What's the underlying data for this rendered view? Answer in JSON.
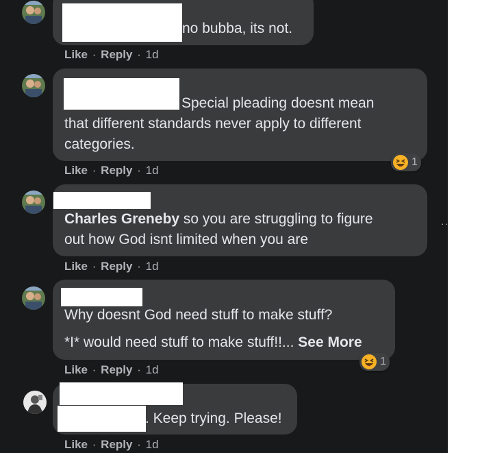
{
  "comments": [
    {
      "text": "no bubba, its not.",
      "actions": {
        "like": "Like",
        "reply": "Reply",
        "sep": "·",
        "time": "1d"
      }
    },
    {
      "text": "Special pleading doesnt mean that different standards never apply to different categories.",
      "line1": "Special pleading doesnt mean",
      "line2": "that different standards never apply to different",
      "line3": "categories.",
      "reaction": {
        "icon": "laughing-emoji",
        "count": "1"
      },
      "actions": {
        "like": "Like",
        "reply": "Reply",
        "sep": "·",
        "time": "1d"
      }
    },
    {
      "mention": "Charles Greneby",
      "line1": " so you are struggling to figure",
      "line2": "out how God isnt limited when you are",
      "actions": {
        "like": "Like",
        "reply": "Reply",
        "sep": "·",
        "time": "1d"
      }
    },
    {
      "line1": "Why doesnt God need stuff to make stuff?",
      "line2": "*I* would need stuff to make stuff!!...",
      "see_more": "See More",
      "reaction": {
        "icon": "laughing-emoji",
        "count": "1"
      },
      "actions": {
        "like": "Like",
        "reply": "Reply",
        "sep": "·",
        "time": "1d"
      }
    },
    {
      "text": ". Keep trying. Please!",
      "actions": {
        "like": "Like",
        "reply": "Reply",
        "sep": "·",
        "time": "1d"
      }
    }
  ],
  "more_options": "···",
  "colors": {
    "background": "#18191a",
    "bubble": "#3a3b3c",
    "text": "#e4e6eb",
    "meta": "#b0b3b8"
  }
}
